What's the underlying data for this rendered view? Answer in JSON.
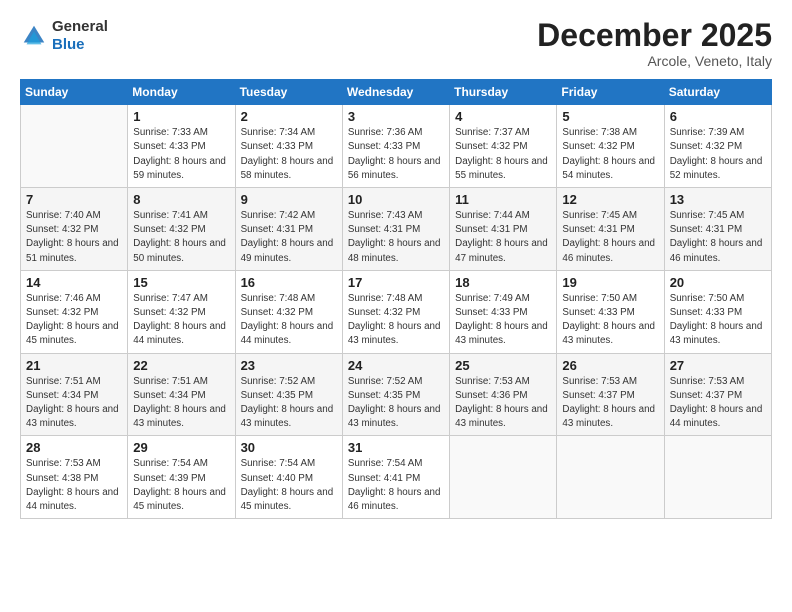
{
  "header": {
    "logo_general": "General",
    "logo_blue": "Blue",
    "month_title": "December 2025",
    "location": "Arcole, Veneto, Italy"
  },
  "days_of_week": [
    "Sunday",
    "Monday",
    "Tuesday",
    "Wednesday",
    "Thursday",
    "Friday",
    "Saturday"
  ],
  "weeks": [
    [
      {
        "day": "",
        "sunrise": "",
        "sunset": "",
        "daylight": ""
      },
      {
        "day": "1",
        "sunrise": "Sunrise: 7:33 AM",
        "sunset": "Sunset: 4:33 PM",
        "daylight": "Daylight: 8 hours and 59 minutes."
      },
      {
        "day": "2",
        "sunrise": "Sunrise: 7:34 AM",
        "sunset": "Sunset: 4:33 PM",
        "daylight": "Daylight: 8 hours and 58 minutes."
      },
      {
        "day": "3",
        "sunrise": "Sunrise: 7:36 AM",
        "sunset": "Sunset: 4:33 PM",
        "daylight": "Daylight: 8 hours and 56 minutes."
      },
      {
        "day": "4",
        "sunrise": "Sunrise: 7:37 AM",
        "sunset": "Sunset: 4:32 PM",
        "daylight": "Daylight: 8 hours and 55 minutes."
      },
      {
        "day": "5",
        "sunrise": "Sunrise: 7:38 AM",
        "sunset": "Sunset: 4:32 PM",
        "daylight": "Daylight: 8 hours and 54 minutes."
      },
      {
        "day": "6",
        "sunrise": "Sunrise: 7:39 AM",
        "sunset": "Sunset: 4:32 PM",
        "daylight": "Daylight: 8 hours and 52 minutes."
      }
    ],
    [
      {
        "day": "7",
        "sunrise": "Sunrise: 7:40 AM",
        "sunset": "Sunset: 4:32 PM",
        "daylight": "Daylight: 8 hours and 51 minutes."
      },
      {
        "day": "8",
        "sunrise": "Sunrise: 7:41 AM",
        "sunset": "Sunset: 4:32 PM",
        "daylight": "Daylight: 8 hours and 50 minutes."
      },
      {
        "day": "9",
        "sunrise": "Sunrise: 7:42 AM",
        "sunset": "Sunset: 4:31 PM",
        "daylight": "Daylight: 8 hours and 49 minutes."
      },
      {
        "day": "10",
        "sunrise": "Sunrise: 7:43 AM",
        "sunset": "Sunset: 4:31 PM",
        "daylight": "Daylight: 8 hours and 48 minutes."
      },
      {
        "day": "11",
        "sunrise": "Sunrise: 7:44 AM",
        "sunset": "Sunset: 4:31 PM",
        "daylight": "Daylight: 8 hours and 47 minutes."
      },
      {
        "day": "12",
        "sunrise": "Sunrise: 7:45 AM",
        "sunset": "Sunset: 4:31 PM",
        "daylight": "Daylight: 8 hours and 46 minutes."
      },
      {
        "day": "13",
        "sunrise": "Sunrise: 7:45 AM",
        "sunset": "Sunset: 4:31 PM",
        "daylight": "Daylight: 8 hours and 46 minutes."
      }
    ],
    [
      {
        "day": "14",
        "sunrise": "Sunrise: 7:46 AM",
        "sunset": "Sunset: 4:32 PM",
        "daylight": "Daylight: 8 hours and 45 minutes."
      },
      {
        "day": "15",
        "sunrise": "Sunrise: 7:47 AM",
        "sunset": "Sunset: 4:32 PM",
        "daylight": "Daylight: 8 hours and 44 minutes."
      },
      {
        "day": "16",
        "sunrise": "Sunrise: 7:48 AM",
        "sunset": "Sunset: 4:32 PM",
        "daylight": "Daylight: 8 hours and 44 minutes."
      },
      {
        "day": "17",
        "sunrise": "Sunrise: 7:48 AM",
        "sunset": "Sunset: 4:32 PM",
        "daylight": "Daylight: 8 hours and 43 minutes."
      },
      {
        "day": "18",
        "sunrise": "Sunrise: 7:49 AM",
        "sunset": "Sunset: 4:33 PM",
        "daylight": "Daylight: 8 hours and 43 minutes."
      },
      {
        "day": "19",
        "sunrise": "Sunrise: 7:50 AM",
        "sunset": "Sunset: 4:33 PM",
        "daylight": "Daylight: 8 hours and 43 minutes."
      },
      {
        "day": "20",
        "sunrise": "Sunrise: 7:50 AM",
        "sunset": "Sunset: 4:33 PM",
        "daylight": "Daylight: 8 hours and 43 minutes."
      }
    ],
    [
      {
        "day": "21",
        "sunrise": "Sunrise: 7:51 AM",
        "sunset": "Sunset: 4:34 PM",
        "daylight": "Daylight: 8 hours and 43 minutes."
      },
      {
        "day": "22",
        "sunrise": "Sunrise: 7:51 AM",
        "sunset": "Sunset: 4:34 PM",
        "daylight": "Daylight: 8 hours and 43 minutes."
      },
      {
        "day": "23",
        "sunrise": "Sunrise: 7:52 AM",
        "sunset": "Sunset: 4:35 PM",
        "daylight": "Daylight: 8 hours and 43 minutes."
      },
      {
        "day": "24",
        "sunrise": "Sunrise: 7:52 AM",
        "sunset": "Sunset: 4:35 PM",
        "daylight": "Daylight: 8 hours and 43 minutes."
      },
      {
        "day": "25",
        "sunrise": "Sunrise: 7:53 AM",
        "sunset": "Sunset: 4:36 PM",
        "daylight": "Daylight: 8 hours and 43 minutes."
      },
      {
        "day": "26",
        "sunrise": "Sunrise: 7:53 AM",
        "sunset": "Sunset: 4:37 PM",
        "daylight": "Daylight: 8 hours and 43 minutes."
      },
      {
        "day": "27",
        "sunrise": "Sunrise: 7:53 AM",
        "sunset": "Sunset: 4:37 PM",
        "daylight": "Daylight: 8 hours and 44 minutes."
      }
    ],
    [
      {
        "day": "28",
        "sunrise": "Sunrise: 7:53 AM",
        "sunset": "Sunset: 4:38 PM",
        "daylight": "Daylight: 8 hours and 44 minutes."
      },
      {
        "day": "29",
        "sunrise": "Sunrise: 7:54 AM",
        "sunset": "Sunset: 4:39 PM",
        "daylight": "Daylight: 8 hours and 45 minutes."
      },
      {
        "day": "30",
        "sunrise": "Sunrise: 7:54 AM",
        "sunset": "Sunset: 4:40 PM",
        "daylight": "Daylight: 8 hours and 45 minutes."
      },
      {
        "day": "31",
        "sunrise": "Sunrise: 7:54 AM",
        "sunset": "Sunset: 4:41 PM",
        "daylight": "Daylight: 8 hours and 46 minutes."
      },
      {
        "day": "",
        "sunrise": "",
        "sunset": "",
        "daylight": ""
      },
      {
        "day": "",
        "sunrise": "",
        "sunset": "",
        "daylight": ""
      },
      {
        "day": "",
        "sunrise": "",
        "sunset": "",
        "daylight": ""
      }
    ]
  ]
}
